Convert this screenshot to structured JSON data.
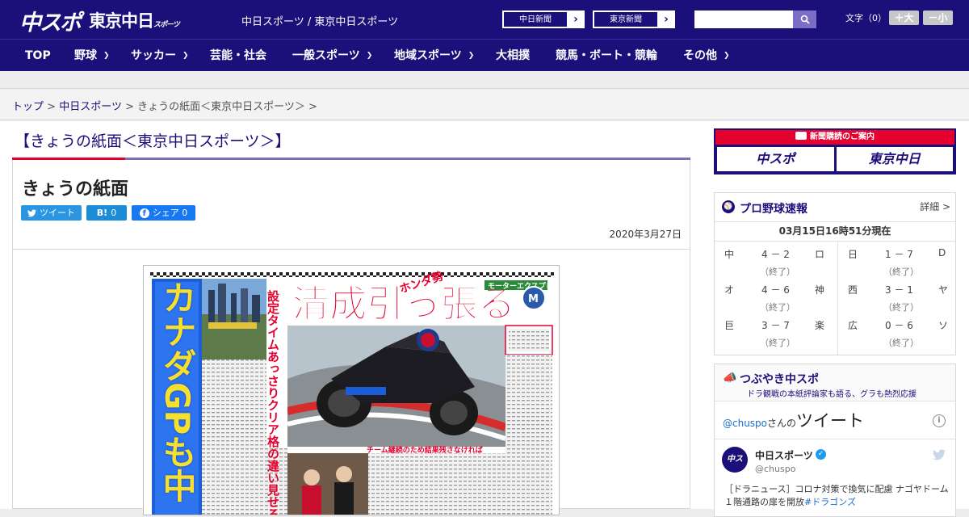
{
  "header": {
    "logo_chuspo": "中スポ",
    "logo_tokyo": "東京中日",
    "logo_tokyo_small": "スポーツ",
    "subtitle": "中日スポーツ / 東京中日スポーツ",
    "ext_links": [
      "中日新聞",
      "東京新聞"
    ],
    "search": {
      "placeholder": ""
    },
    "font_size": {
      "label": "文字（0）",
      "plus": "＋大",
      "minus": "－小"
    }
  },
  "nav": {
    "items": [
      {
        "label": "TOP",
        "dropdown": false
      },
      {
        "label": "野球",
        "dropdown": true
      },
      {
        "label": "サッカー",
        "dropdown": true
      },
      {
        "label": "芸能・社会",
        "dropdown": false
      },
      {
        "label": "一般スポーツ",
        "dropdown": true
      },
      {
        "label": "地域スポーツ",
        "dropdown": true
      },
      {
        "label": "大相撲",
        "dropdown": false
      },
      {
        "label": "競馬・ボート・競輪",
        "dropdown": false
      },
      {
        "label": "その他",
        "dropdown": true
      }
    ]
  },
  "breadcrumb": {
    "top": "トップ",
    "sep": ">",
    "chunichi": "中日スポーツ",
    "current": "きょうの紙面＜東京中日スポーツ＞ >"
  },
  "section_title": "【きょうの紙面＜東京中日スポーツ＞】",
  "article": {
    "title": "きょうの紙面",
    "share": {
      "twitter": "ツイート",
      "hatena": "0",
      "facebook": "シェア 0"
    },
    "date": "2020年3月27日",
    "paper": {
      "headline_vertical": "カナダGPも中",
      "headline_main": "清成引っ張る",
      "headline_tag": "ホンダ勢",
      "subhead": "設定タイムあっさりクリア格の違い見せる",
      "caption": "チーム継続のため結果残さなければ",
      "corner": "モーターエクスプレス"
    }
  },
  "sidebar": {
    "banner": {
      "head": "新聞購読のご案内",
      "logo1": "中スポ",
      "logo2": "東京中日"
    },
    "baseball": {
      "title": "プロ野球速報",
      "detail": "詳細 >",
      "time": "03月15日16時51分現在",
      "games": [
        {
          "t1": "中",
          "score": "4 － 2",
          "t2": "ロ",
          "status": "（終了）"
        },
        {
          "t1": "オ",
          "score": "4 － 6",
          "t2": "神",
          "status": "（終了）"
        },
        {
          "t1": "巨",
          "score": "3 － 7",
          "t2": "楽",
          "status": "（終了）"
        },
        {
          "t1": "日",
          "score": "1 － 7",
          "t2": "D",
          "status": "（終了）"
        },
        {
          "t1": "西",
          "score": "3 － 1",
          "t2": "ヤ",
          "status": "（終了）"
        },
        {
          "t1": "広",
          "score": "0 － 6",
          "t2": "ソ",
          "status": "（終了）"
        }
      ]
    },
    "tweets": {
      "title": "つぶやき中スポ",
      "subtitle": "ドラ観戦の本紙評論家も語る、グラも熱烈応援",
      "handle": "@chuspo",
      "handle_suffix": "さんの",
      "handle_big": "ツイート",
      "account_name": "中日スポーツ",
      "account_at": "@chuspo",
      "text": "［ドラニュース］コロナ対策で換気に配慮 ナゴヤドーム１階通路の扉を開放",
      "hashtag": "#ドラゴンズ"
    }
  }
}
